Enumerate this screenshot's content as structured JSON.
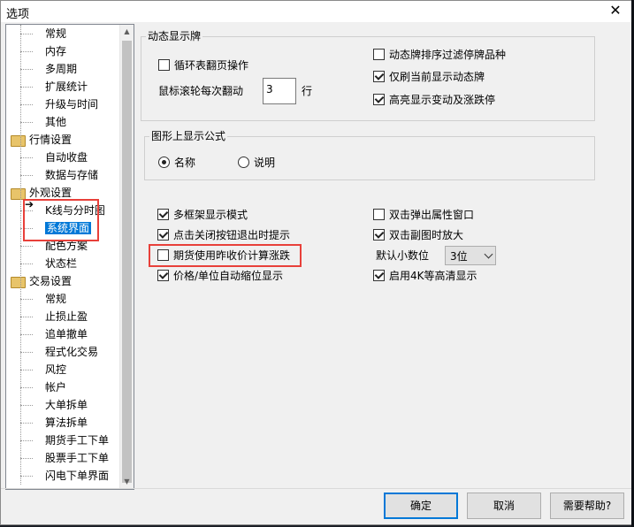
{
  "window": {
    "title": "选项",
    "close_glyph": "✕"
  },
  "tree": {
    "items": [
      {
        "label": "常规",
        "kind": "child",
        "top": 0
      },
      {
        "label": "内存",
        "kind": "child"
      },
      {
        "label": "多周期",
        "kind": "child"
      },
      {
        "label": "扩展统计",
        "kind": "child"
      },
      {
        "label": "升级与时间",
        "kind": "child"
      },
      {
        "label": "其他",
        "kind": "child"
      },
      {
        "label": "行情设置",
        "kind": "group"
      },
      {
        "label": "自动收盘",
        "kind": "child"
      },
      {
        "label": "数据与存储",
        "kind": "child"
      },
      {
        "label": "外观设置",
        "kind": "group"
      },
      {
        "label": "K线与分时图",
        "kind": "child"
      },
      {
        "label": "系统界面",
        "kind": "child",
        "selected": true
      },
      {
        "label": "配色方案",
        "kind": "child"
      },
      {
        "label": "状态栏",
        "kind": "child"
      },
      {
        "label": "交易设置",
        "kind": "group"
      },
      {
        "label": "常规",
        "kind": "child"
      },
      {
        "label": "止损止盈",
        "kind": "child"
      },
      {
        "label": "追单撤单",
        "kind": "child"
      },
      {
        "label": "程式化交易",
        "kind": "child"
      },
      {
        "label": "风控",
        "kind": "child"
      },
      {
        "label": "帐户",
        "kind": "child"
      },
      {
        "label": "大单拆单",
        "kind": "child"
      },
      {
        "label": "算法拆单",
        "kind": "child"
      },
      {
        "label": "期货手工下单",
        "kind": "child"
      },
      {
        "label": "股票手工下单",
        "kind": "child"
      },
      {
        "label": "闪电下单界面",
        "kind": "child"
      }
    ]
  },
  "dynamic_board": {
    "title": "动态显示牌",
    "loop_label": "循环表翻页操作",
    "loop_checked": false,
    "wheel_label": "鼠标滚轮每次翻动",
    "wheel_value": "3",
    "wheel_unit": "行",
    "filter_label": "动态牌排序过滤停牌品种",
    "filter_checked": false,
    "current_label": "仅刷当前显示动态牌",
    "current_checked": true,
    "highlight_label": "高亮显示变动及涨跌停",
    "highlight_checked": true
  },
  "formula": {
    "title": "图形上显示公式",
    "name_label": "名称",
    "name_checked": true,
    "desc_label": "说明",
    "desc_checked": false
  },
  "options": {
    "multi_frame_label": "多框架显示模式",
    "multi_frame_checked": true,
    "close_prompt_label": "点击关闭按钮退出时提示",
    "close_prompt_checked": true,
    "futures_label": "期货使用昨收价计算涨跌",
    "futures_checked": false,
    "auto_scale_label": "价格/单位自动缩位显示",
    "auto_scale_checked": true,
    "dbl_popup_label": "双击弹出属性窗口",
    "dbl_popup_checked": false,
    "dbl_zoom_label": "双击副图时放大",
    "dbl_zoom_checked": true,
    "decimal_label": "默认小数位",
    "decimal_value": "3位",
    "hd_label": "启用4K等高清显示",
    "hd_checked": true
  },
  "buttons": {
    "ok": "确定",
    "cancel": "取消",
    "help": "需要帮助?"
  }
}
